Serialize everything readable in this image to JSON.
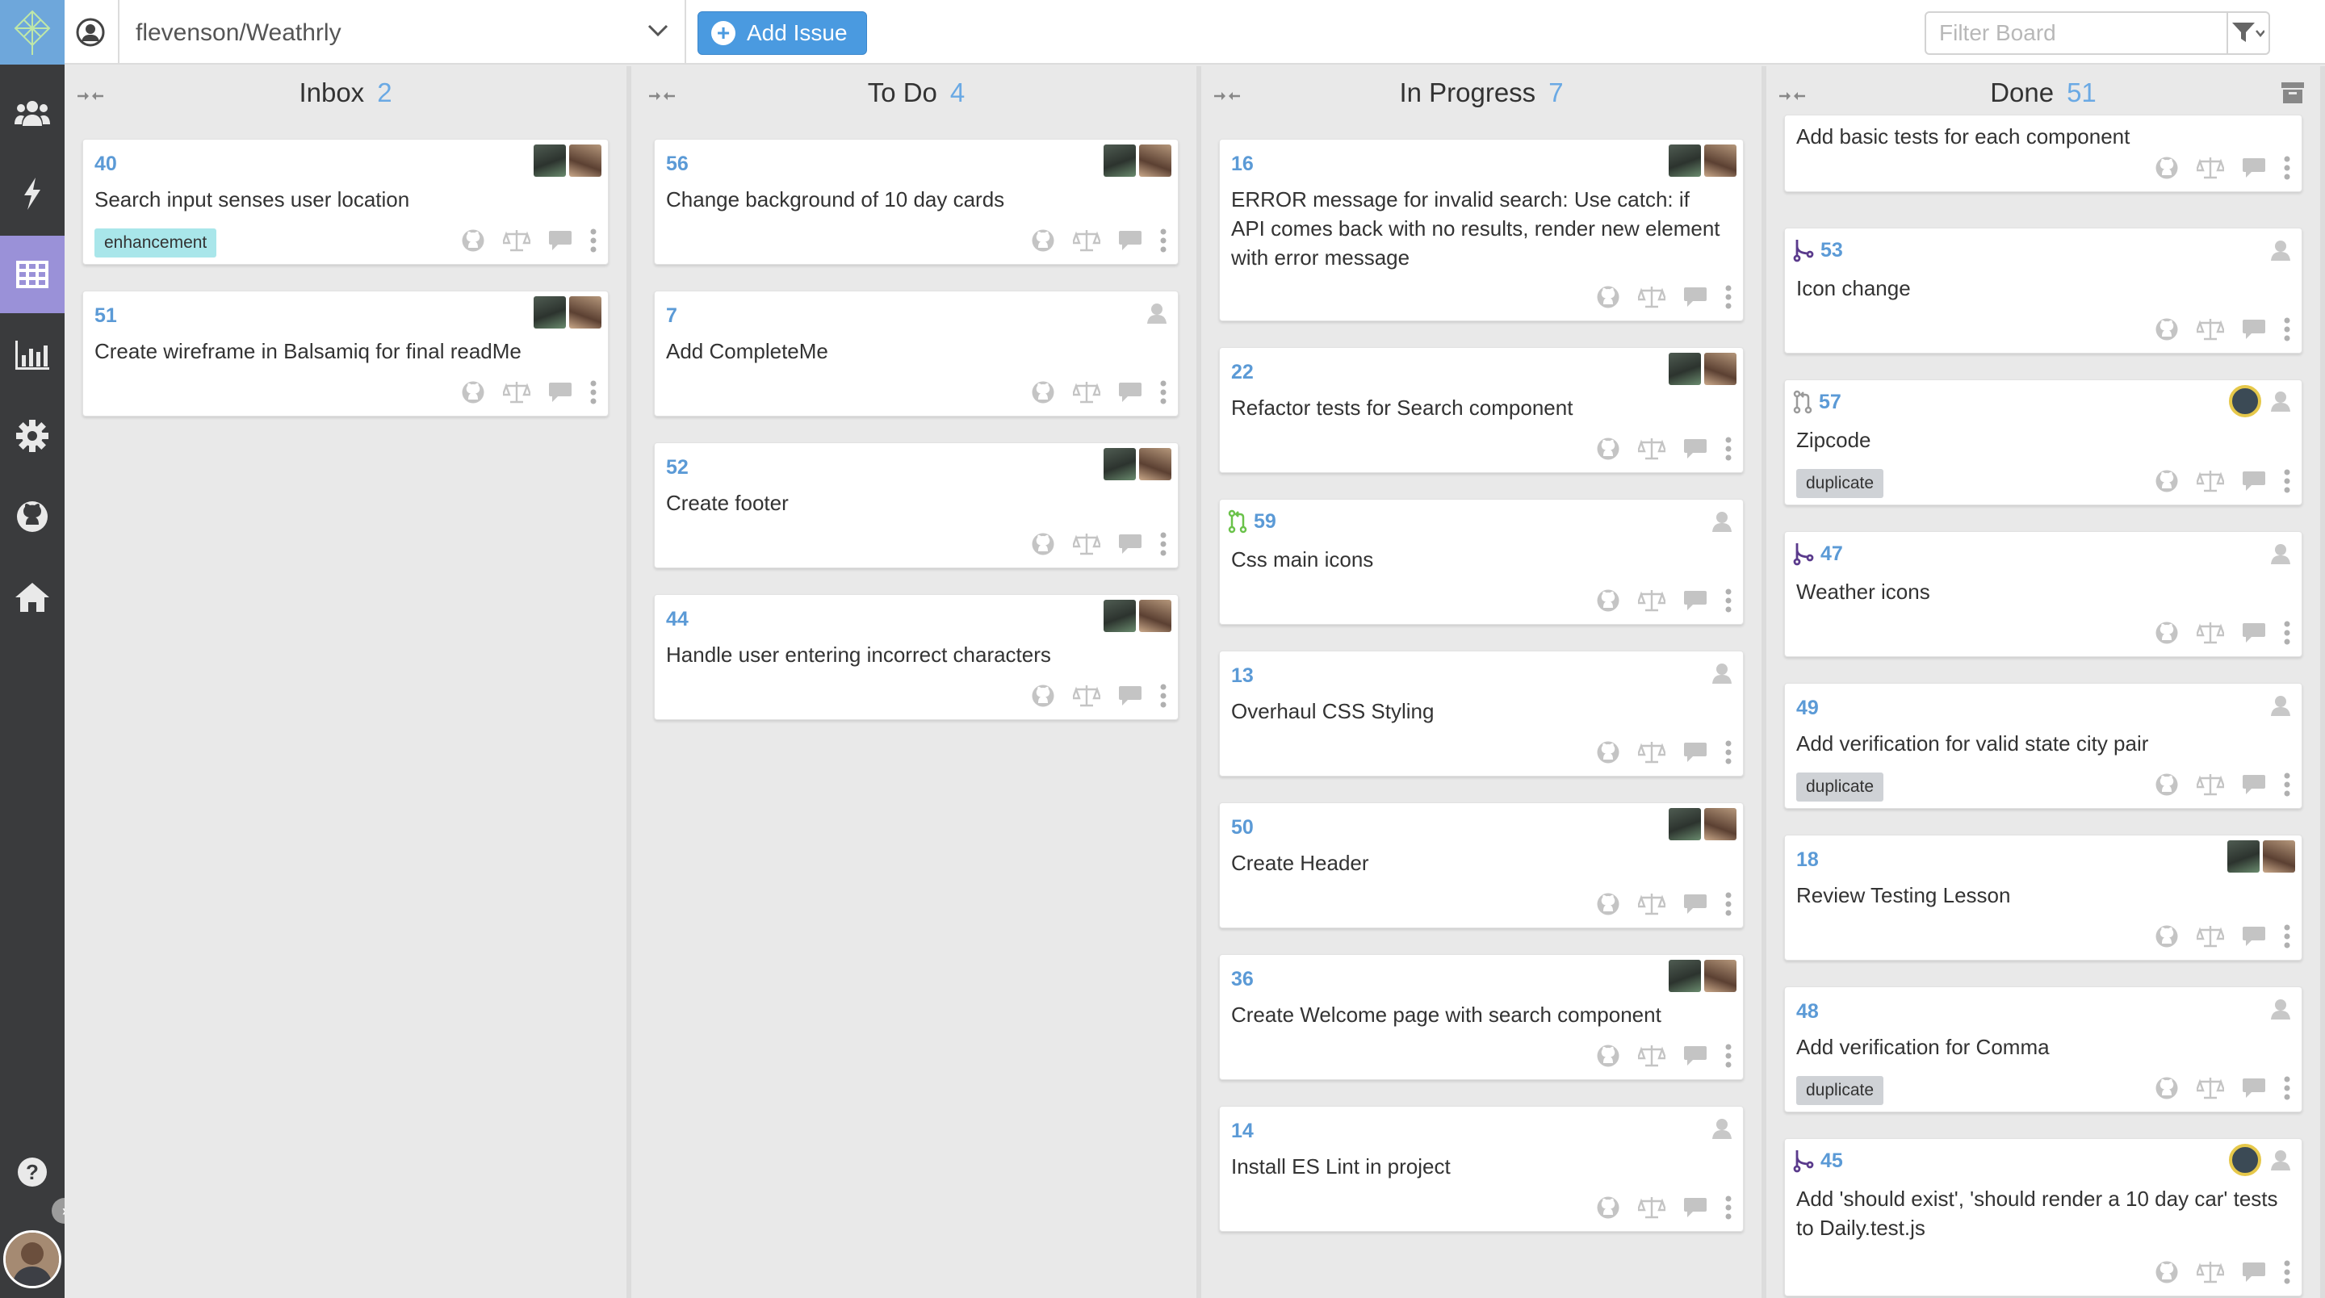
{
  "header": {
    "repo": "flevenson/Weathrly",
    "add_issue": "Add Issue",
    "filter_placeholder": "Filter Board"
  },
  "columns": [
    {
      "title": "Inbox",
      "count": "2",
      "cards": [
        {
          "number": "40",
          "title": "Search input senses user location",
          "label": "enhancement"
        },
        {
          "number": "51",
          "title": "Create wireframe in Balsamiq for final readMe"
        }
      ]
    },
    {
      "title": "To Do",
      "count": "4",
      "cards": [
        {
          "number": "56",
          "title": "Change background of 10 day cards"
        },
        {
          "number": "7",
          "title": "Add CompleteMe"
        },
        {
          "number": "52",
          "title": "Create footer"
        },
        {
          "number": "44",
          "title": "Handle user entering incorrect characters"
        }
      ]
    },
    {
      "title": "In Progress",
      "count": "7",
      "cards": [
        {
          "number": "16",
          "title": "ERROR message for  invalid search:  Use catch: if API comes back with no results, render new element with error message"
        },
        {
          "number": "22",
          "title": "Refactor tests for Search component"
        },
        {
          "number": "59",
          "title": "Css main icons"
        },
        {
          "number": "13",
          "title": "Overhaul CSS Styling"
        },
        {
          "number": "50",
          "title": "Create Header"
        },
        {
          "number": "36",
          "title": "Create Welcome page with search component"
        },
        {
          "number": "14",
          "title": "Install ES Lint in project"
        }
      ]
    },
    {
      "title": "Done",
      "count": "51",
      "cards": [
        {
          "title": "Add basic tests for each component"
        },
        {
          "number": "53",
          "title": "Icon change"
        },
        {
          "number": "57",
          "title": "Zipcode",
          "label": "duplicate"
        },
        {
          "number": "47",
          "title": "Weather icons"
        },
        {
          "number": "49",
          "title": "Add verification for valid state city pair",
          "label": "duplicate"
        },
        {
          "number": "18",
          "title": "Review Testing Lesson"
        },
        {
          "number": "48",
          "title": "Add verification for Comma",
          "label": "duplicate"
        },
        {
          "number": "45",
          "title": "Add 'should exist', 'should render a 10 day car' tests to Daily.test.js"
        }
      ]
    }
  ],
  "colors": {
    "accent": "#4a9ae0",
    "sidebar": "#3a3b3d",
    "sidebar_active": "#9a91d8",
    "issue_number": "#5b9ad6",
    "label_enhancement": "#a9e6ea",
    "label_duplicate": "#cfd2d6"
  }
}
